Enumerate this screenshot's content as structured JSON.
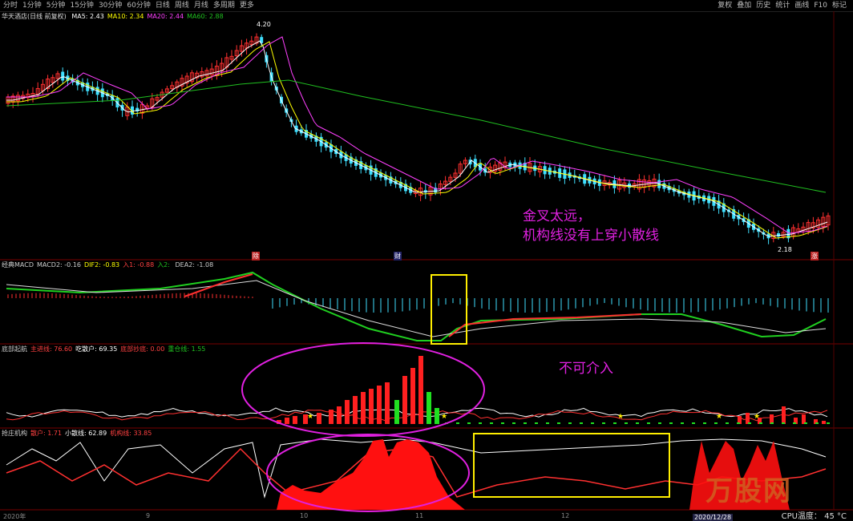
{
  "toolbar": {
    "left_items": [
      "分时",
      "1分钟",
      "5分钟",
      "15分钟",
      "30分钟",
      "60分钟",
      "日线",
      "周线",
      "月线",
      "多周期",
      "更多"
    ],
    "active": "日线",
    "right_items": [
      "复权",
      "叠加",
      "历史",
      "统计",
      "画线",
      "F10",
      "标记"
    ]
  },
  "main_panel": {
    "title": "华天酒店(日线 前复权)",
    "ma_items": [
      {
        "label": "MA5: 2.43",
        "color": "#ffffff"
      },
      {
        "label": "MA10: 2.34",
        "color": "#ffff00"
      },
      {
        "label": "MA20: 2.44",
        "color": "#ff40ff"
      },
      {
        "label": "MA60: 2.88",
        "color": "#20c020"
      }
    ],
    "high_label": "4.20",
    "low_label": "2.18",
    "tags": [
      "除",
      "财",
      "涨"
    ]
  },
  "macd_panel": {
    "items": [
      {
        "label": "经典MACD",
        "color": "#cccccc"
      },
      {
        "label": "MACD2: -0.16",
        "color": "#cccccc"
      },
      {
        "label": "DIF2: -0.83",
        "color": "#ffff00"
      },
      {
        "label": "入1: -0.88",
        "color": "#ff4040"
      },
      {
        "label": "入2: ",
        "color": "#20c020"
      },
      {
        "label": "DEA2: -1.08",
        "color": "#cccccc"
      }
    ]
  },
  "bottom_panel": {
    "items": [
      {
        "label": "底部起航",
        "color": "#cccccc"
      },
      {
        "label": "主进线: 76.60",
        "color": "#ff4040"
      },
      {
        "label": "吃散户: 69.35",
        "color": "#ffffff"
      },
      {
        "label": "底部抄底: 0.00",
        "color": "#ff4040"
      },
      {
        "label": "重仓线: 1.55",
        "color": "#20c020"
      }
    ]
  },
  "zhuang_panel": {
    "items": [
      {
        "label": "抢庄机构",
        "color": "#cccccc"
      },
      {
        "label": "散户: 1.71",
        "color": "#ff4040"
      },
      {
        "label": "小散线: 62.89",
        "color": "#ffffff"
      },
      {
        "label": "机构线: 33.85",
        "color": "#ff4040"
      }
    ]
  },
  "annotations": {
    "note1_line1": "金叉太远，",
    "note1_line2": "机构线没有上穿小散线",
    "note2": "不可介入"
  },
  "axis": {
    "labels": [
      "2020年",
      "9",
      "10",
      "11",
      "12"
    ]
  },
  "footer": {
    "date": "2020/12/28",
    "cpu": "CPU温度：  45 °C"
  },
  "watermark": "万股网",
  "colors": {
    "up": "#ff3030",
    "down": "#40e0ff",
    "annotation": "#e020e0",
    "box": "#ffee00"
  }
}
